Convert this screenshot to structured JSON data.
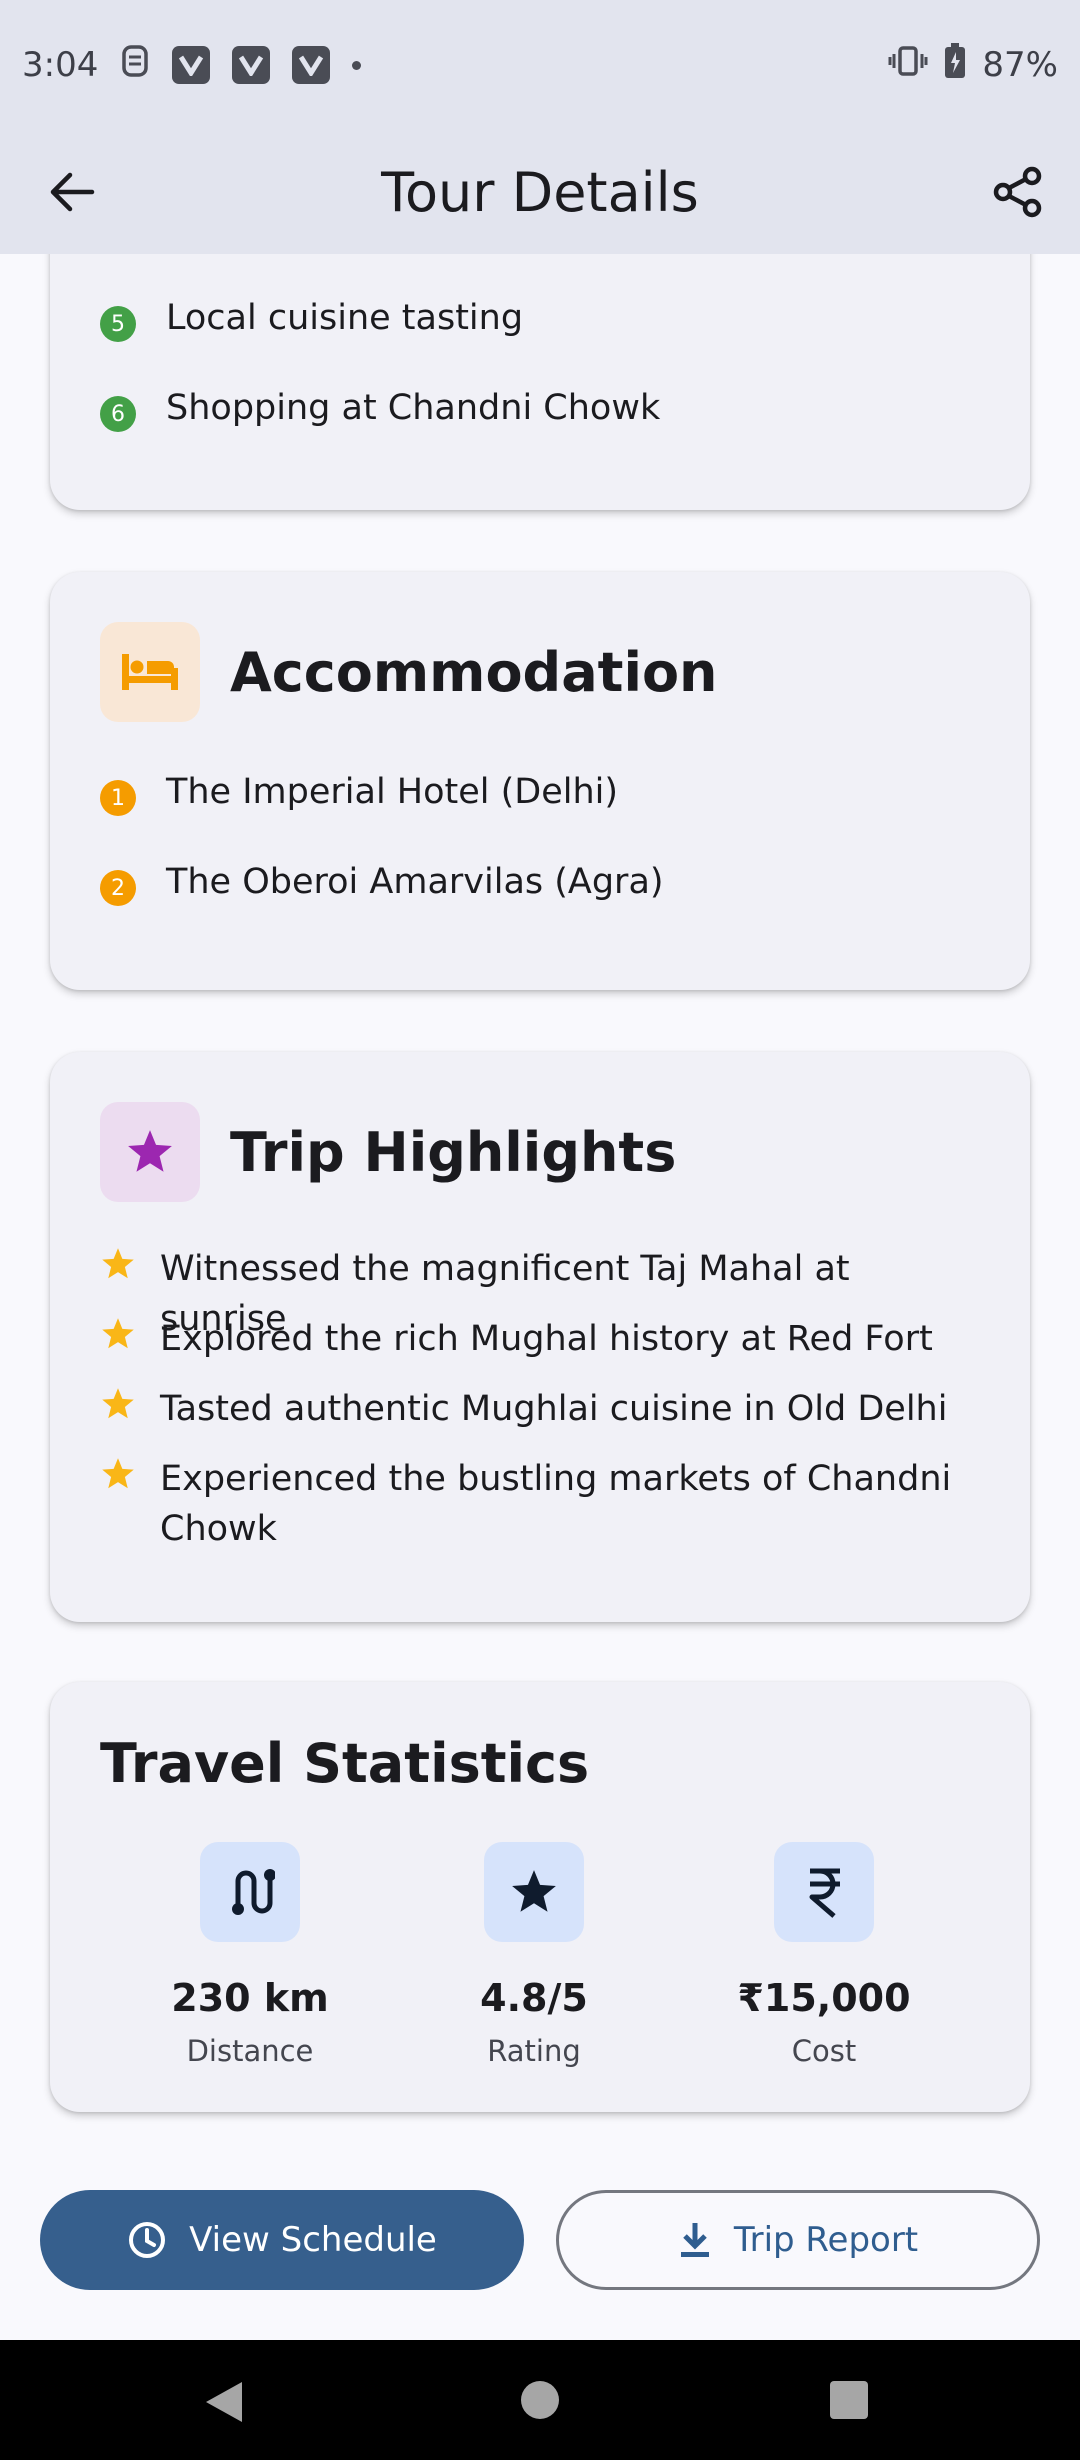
{
  "status": {
    "time": "3:04",
    "battery": "87%"
  },
  "app_bar": {
    "title": "Tour Details"
  },
  "itinerary_tail": {
    "items": [
      {
        "number": "5",
        "text": "Local cuisine tasting"
      },
      {
        "number": "6",
        "text": "Shopping at Chandni Chowk"
      }
    ],
    "badge_color": "#43a047"
  },
  "accommodation": {
    "title": "Accommodation",
    "icon": "bed-icon",
    "accent": "#f59c00",
    "items": [
      {
        "number": "1",
        "text": "The Imperial Hotel (Delhi)"
      },
      {
        "number": "2",
        "text": "The Oberoi Amarvilas (Agra)"
      }
    ]
  },
  "highlights": {
    "title": "Trip Highlights",
    "icon": "star-icon",
    "accent": "#9c27b0",
    "star_color": "#f9b617",
    "items": [
      "Witnessed the magnificent Taj Mahal at sunrise",
      "Explored the rich Mughal history at Red Fort",
      "Tasted authentic Mughlai cuisine in Old Delhi",
      "Experienced the bustling markets of Chandni Chowk"
    ]
  },
  "stats": {
    "title": "Travel Statistics",
    "items": [
      {
        "icon": "route-icon",
        "value": "230 km",
        "label": "Distance"
      },
      {
        "icon": "star-icon",
        "value": "4.8/5",
        "label": "Rating"
      },
      {
        "icon": "rupee-icon",
        "value": "₹15,000",
        "label": "Cost"
      }
    ]
  },
  "actions": {
    "view_schedule": "View Schedule",
    "trip_report": "Trip Report"
  }
}
